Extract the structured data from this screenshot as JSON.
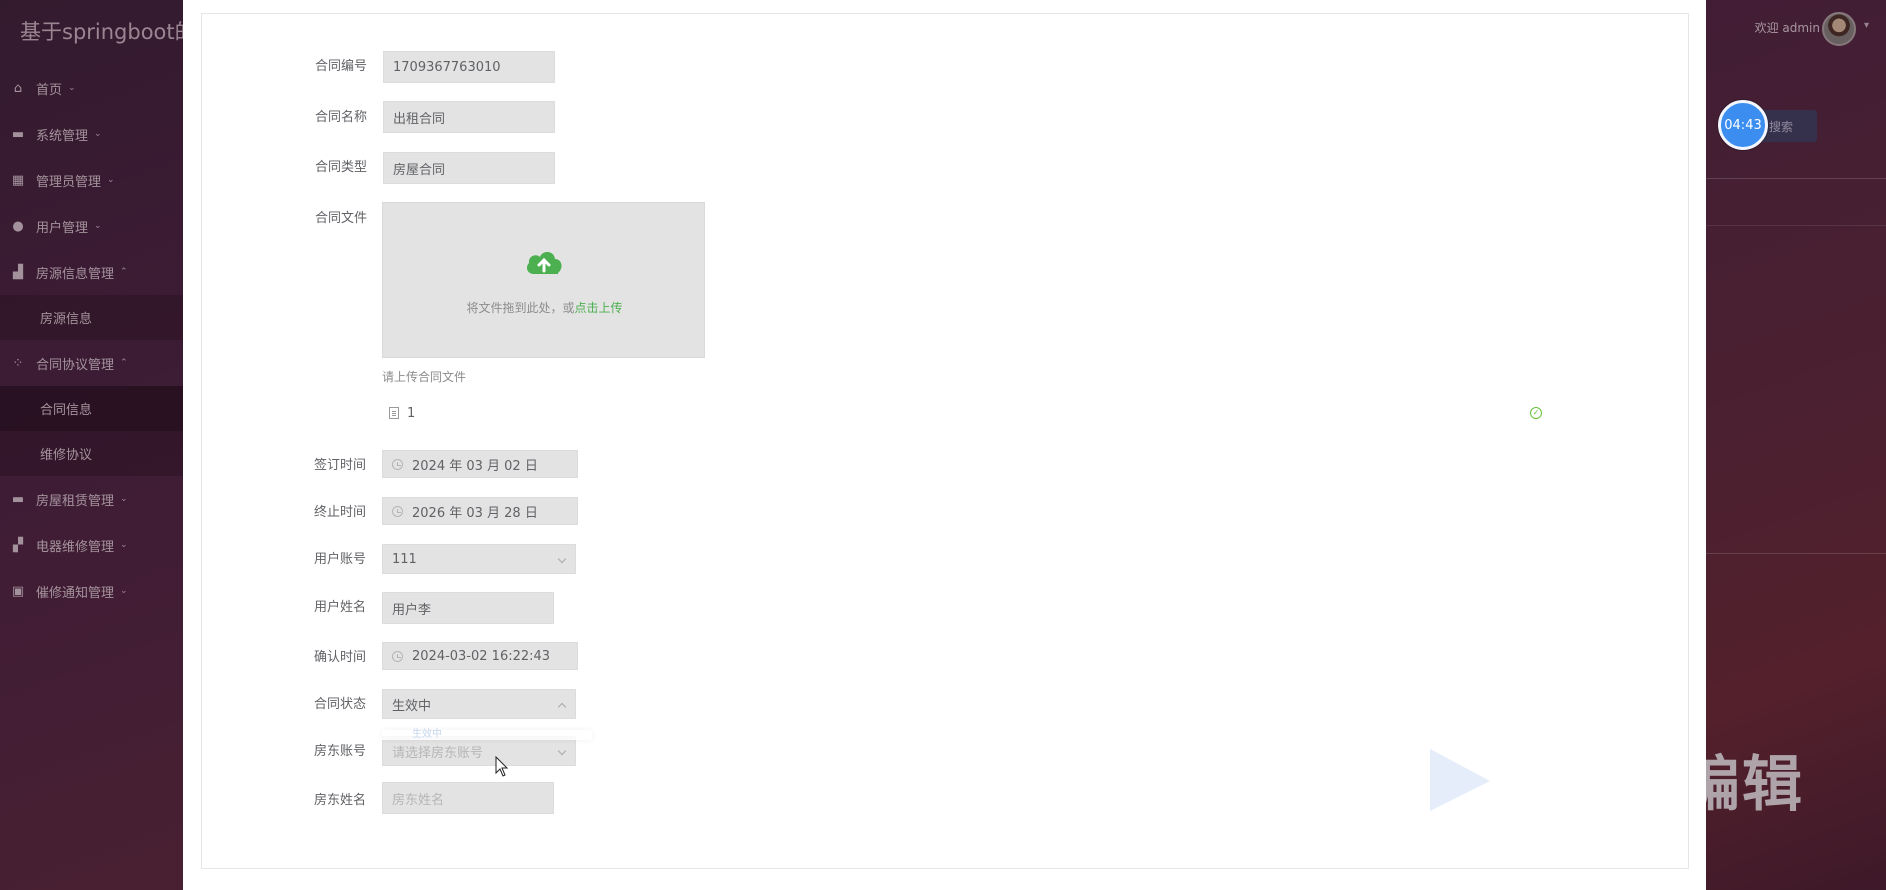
{
  "app": {
    "title": "基于springboot的",
    "welcome": "欢迎 admin",
    "search_label": "搜索",
    "timer": "04:43",
    "edit_caption": "编辑"
  },
  "sidebar": {
    "items": [
      {
        "label": "首页",
        "icon": "home-icon",
        "caret": "⌄"
      },
      {
        "label": "系统管理",
        "icon": "system-icon",
        "caret": "⌄"
      },
      {
        "label": "管理员管理",
        "icon": "grid-icon",
        "caret": "⌄"
      },
      {
        "label": "用户管理",
        "icon": "user-icon",
        "caret": "⌄"
      },
      {
        "label": "房源信息管理",
        "icon": "building-icon",
        "caret": "⌃"
      },
      {
        "label": "房源信息",
        "sub": true
      },
      {
        "label": "合同协议管理",
        "icon": "apps-icon",
        "caret": "⌃"
      },
      {
        "label": "合同信息",
        "sub": true,
        "active": true
      },
      {
        "label": "维修协议",
        "sub": true
      },
      {
        "label": "房屋租赁管理",
        "icon": "house-icon",
        "caret": "⌄"
      },
      {
        "label": "电器维修管理",
        "icon": "plug-icon",
        "caret": "⌄"
      },
      {
        "label": "催修通知管理",
        "icon": "briefcase-icon",
        "caret": "⌄"
      }
    ]
  },
  "form": {
    "contract_no": {
      "label": "合同编号",
      "value": "1709367763010"
    },
    "contract_name": {
      "label": "合同名称",
      "value": "出租合同"
    },
    "contract_type": {
      "label": "合同类型",
      "value": "房屋合同"
    },
    "contract_file": {
      "label": "合同文件",
      "drop_text": "将文件拖到此处，或",
      "drop_link": "点击上传",
      "tip": "请上传合同文件",
      "file_name": "1"
    },
    "sign_time": {
      "label": "签订时间",
      "value": "2024 年 03 月 02 日"
    },
    "end_time": {
      "label": "终止时间",
      "value": "2026 年 03 月 28 日"
    },
    "user_account": {
      "label": "用户账号",
      "value": "111"
    },
    "user_name": {
      "label": "用户姓名",
      "value": "用户李"
    },
    "confirm_time": {
      "label": "确认时间",
      "value": "2024-03-02 16:22:43"
    },
    "contract_status": {
      "label": "合同状态",
      "value": "生效中"
    },
    "landlord_account": {
      "label": "房东账号",
      "placeholder": "请选择房东账号",
      "overlay_value": "生效中"
    },
    "landlord_name": {
      "label": "房东姓名",
      "placeholder": "房东姓名"
    }
  },
  "colors": {
    "accent_green": "#4caf50",
    "timer_blue": "#3b8ef0",
    "sidebar_text": "#e5d8df"
  }
}
